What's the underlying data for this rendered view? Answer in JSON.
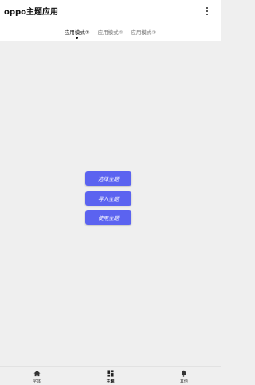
{
  "app": {
    "title": "oppo主题应用"
  },
  "tabs": [
    {
      "label": "应用模式①",
      "active": true
    },
    {
      "label": "应用模式②",
      "active": false
    },
    {
      "label": "应用模式③",
      "active": false
    }
  ],
  "actions": {
    "select_theme": "选择主题",
    "import_theme": "导入主题",
    "apply_theme": "使用主题"
  },
  "bottom_nav": [
    {
      "label": "字体",
      "icon": "home-icon"
    },
    {
      "label": "主题",
      "icon": "grid-icon"
    },
    {
      "label": "其他",
      "icon": "bell-icon"
    }
  ],
  "colors": {
    "accent": "#5b63f0",
    "background": "#efefef"
  }
}
